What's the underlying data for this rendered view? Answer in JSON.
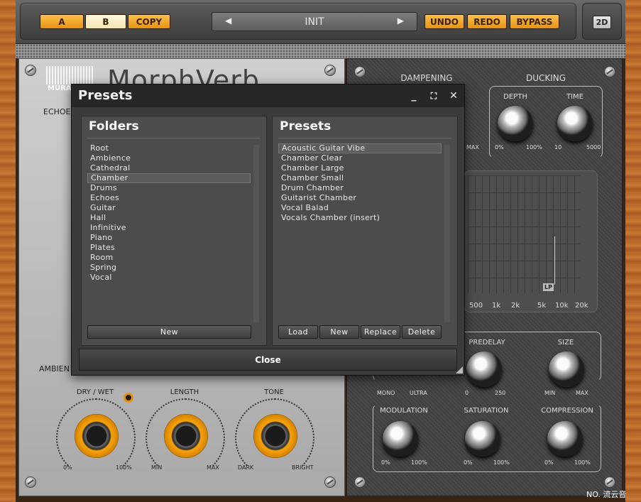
{
  "topbar": {
    "a_label": "A",
    "b_label": "B",
    "copy_label": "COPY",
    "preset_name": "INIT",
    "prev_glyph": "◀",
    "next_glyph": "▶",
    "undo_label": "UNDO",
    "redo_label": "REDO",
    "bypass_label": "BYPASS",
    "view_label": "2D",
    "accent_color": "#f0a020"
  },
  "left_panel": {
    "logo_title": "MorphVerb",
    "logo_brand": "MURA AU",
    "echoes_label": "ECHOES",
    "ambience_label": "AMBIEN",
    "knobs": [
      {
        "label": "DRY / WET",
        "min": "0%",
        "max": "100%"
      },
      {
        "label": "LENGTH",
        "min": "MIN",
        "max": "MAX"
      },
      {
        "label": "TONE",
        "min": "DARK",
        "max": "BRIGHT"
      }
    ]
  },
  "right_panel": {
    "dampening_title": "DAMPENING",
    "dampening_max": "MAX",
    "ducking_title": "DUCKING",
    "depth_label": "DEPTH",
    "depth_min": "0%",
    "depth_max": "100%",
    "time_label": "TIME",
    "time_min": "10",
    "time_max": "5000",
    "eq_ticks": [
      "500",
      "1k",
      "2k",
      "5k",
      "10k",
      "20k"
    ],
    "lp_label": "LP",
    "predelay_label": "PREDELAY",
    "predelay_min": "0",
    "predelay_max": "250",
    "size_label": "SIZE",
    "size_min": "MIN",
    "size_max": "MAX",
    "width_min": "MONO",
    "width_max": "ULTRA",
    "modulation_label": "MODULATION",
    "modulation_min": "0%",
    "modulation_max": "100%",
    "saturation_label": "SATURATION",
    "saturation_min": "0%",
    "saturation_max": "100%",
    "compression_label": "COMPRESSION",
    "compression_min": "0%",
    "compression_max": "100%"
  },
  "modal": {
    "title": "Presets",
    "minimize_glyph": "_",
    "maximize_glyph": "⛶",
    "close_glyph": "✕",
    "folders": {
      "title": "Folders",
      "items": [
        "Root",
        "Ambience",
        "Cathedral",
        "Chamber",
        "Drums",
        "Echoes",
        "Guitar",
        "Hall",
        "Infinitive",
        "Piano",
        "Plates",
        "Room",
        "Spring",
        "Vocal"
      ],
      "selected": "Chamber",
      "new_label": "New"
    },
    "presets": {
      "title": "Presets",
      "items": [
        "Acoustic Guitar Vibe",
        "Chamber Clear",
        "Chamber Large",
        "Chamber Small",
        "Drum Chamber",
        "Guitarist Chamber",
        "Vocal Balad",
        "Vocals Chamber (insert)"
      ],
      "selected": "Acoustic Guitar Vibe",
      "load_label": "Load",
      "new_label": "New",
      "replace_label": "Replace",
      "delete_label": "Delete"
    },
    "close_label": "Close"
  },
  "watermark": "NO. 流云音"
}
